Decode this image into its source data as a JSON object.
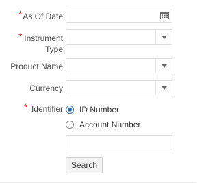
{
  "form": {
    "as_of_date": {
      "required_mark": "*",
      "label": "As Of Date",
      "value": ""
    },
    "instrument_type": {
      "required_mark": "*",
      "label_line1": "Instrument",
      "label_line2": "Type",
      "selected": ""
    },
    "product_name": {
      "label": "Product Name",
      "selected": ""
    },
    "currency": {
      "label": "Currency",
      "selected": ""
    },
    "identifier": {
      "required_mark": "*",
      "label": "Identifier",
      "options": [
        {
          "label": "ID Number",
          "selected": true
        },
        {
          "label": "Account Number",
          "selected": false
        }
      ],
      "value": ""
    },
    "search_button": "Search"
  },
  "icons": {
    "calendar": "calendar-icon",
    "dropdown": "chevron-down-icon"
  },
  "colors": {
    "required": "#d62c20",
    "radio_selected": "#2b6cb0",
    "border": "#dcdcdc"
  }
}
